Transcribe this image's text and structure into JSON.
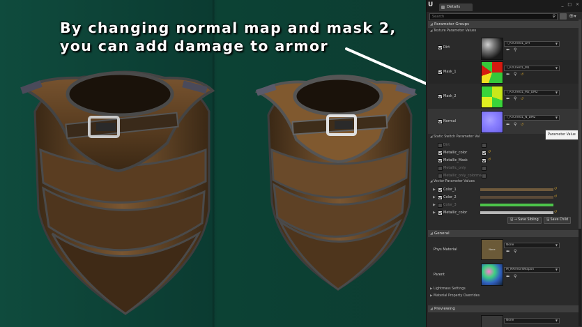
{
  "caption": {
    "line1": "By changing normal map and mask 2,",
    "line2": "you can add damage to armor"
  },
  "panel": {
    "logo": "U",
    "tab_label": "Details",
    "window_buttons": "_ □ ×",
    "search_placeholder": "Search",
    "sections": {
      "parameter_groups": "Parameter Groups",
      "texture_params": "Texture Parameter Values",
      "static_switch": "Static Switch Parameter Val",
      "vector_params": "Vector Parameter Values",
      "general": "General",
      "previewing": "Previewing"
    },
    "textures": [
      {
        "label": "Dirt",
        "value": "T_P2Chest1_DH",
        "colors": [
          "#1a1a1a",
          "#7a7a7a",
          "#d0d0d0"
        ]
      },
      {
        "label": "Mask_1",
        "value": "T_P2Chest1_M1",
        "colors": [
          "#d41a10",
          "#35c83a",
          "#f0e020"
        ]
      },
      {
        "label": "Mask_2",
        "value": "T_P2Chest1_M2_DM2",
        "colors": [
          "#c8e81a",
          "#3ad43a",
          "#e0f020"
        ]
      },
      {
        "label": "Normal",
        "value": "T_P2Chest1_N_DM2",
        "colors": [
          "#8a80ff",
          "#6a60e8",
          "#a8a0ff"
        ]
      }
    ],
    "switches": [
      {
        "label": "Dirt",
        "enabled": false,
        "value_checked": false
      },
      {
        "label": "Metallic_color",
        "enabled": true,
        "value_checked": true
      },
      {
        "label": "Metallic_Mask",
        "enabled": true,
        "value_checked": true
      },
      {
        "label": "Metallic_only",
        "enabled": false,
        "value_checked": false
      },
      {
        "label": "Metallic_only_colormap",
        "enabled": false,
        "value_checked": false
      }
    ],
    "vectors": [
      {
        "label": "Color_1",
        "color": "#6f5a3c",
        "dim": false
      },
      {
        "label": "Color_2",
        "color": "#5a4a38",
        "dim": false
      },
      {
        "label": "Color_3",
        "color": "#4cc44a",
        "dim": true
      },
      {
        "label": "Metallic_color",
        "color": "#b8b8b8",
        "dim": false
      }
    ],
    "save_sibling": "Save Sibling",
    "save_child": "Save Child",
    "phys_material_label": "Phys Material",
    "phys_material_value": "None",
    "phys_material_thumb": "None",
    "parent_label": "Parent",
    "parent_value": "M_MArmorWeapon",
    "lightmass_label": "Lightmass Settings",
    "material_overrides_label": "Material Property Overrides",
    "preview_value": "None",
    "tooltip": "Parameter Value"
  }
}
